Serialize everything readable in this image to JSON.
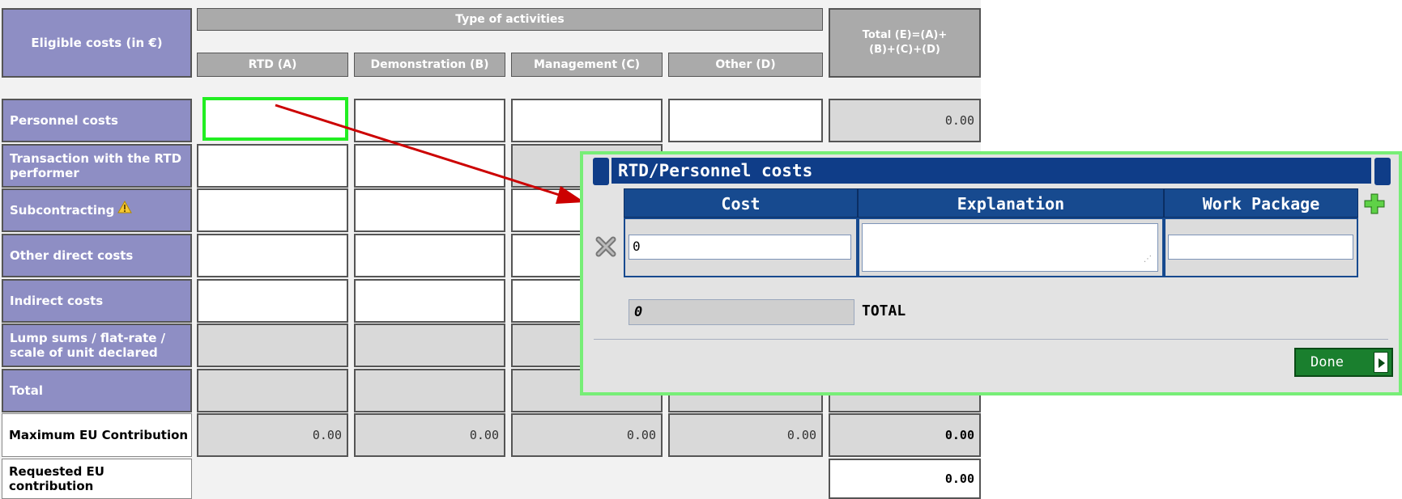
{
  "table": {
    "corner_label": "Eligible costs (in €)",
    "type_header": "Type of activities",
    "columns": [
      "RTD (A)",
      "Demonstration (B)",
      "Management (C)",
      "Other (D)"
    ],
    "total_header_line1": "Total (E)=(A)+",
    "total_header_line2": "(B)+(C)+(D)",
    "rows": [
      {
        "label": "Personnel costs",
        "total": "0.00"
      },
      {
        "label": "Transaction with the RTD performer"
      },
      {
        "label": "Subcontracting"
      },
      {
        "label": "Other direct costs"
      },
      {
        "label": "Indirect costs"
      },
      {
        "label": "Lump sums / flat-rate / scale of unit declared"
      },
      {
        "label": "Total"
      },
      {
        "label": "Maximum EU Contribution",
        "values": [
          "0.00",
          "0.00",
          "0.00",
          "0.00"
        ],
        "total": "0.00"
      },
      {
        "label": "Requested EU contribution",
        "total": "0.00"
      }
    ],
    "warning_icon": "warning-triangle-icon"
  },
  "dialog": {
    "title": "RTD/Personnel costs",
    "col_cost": "Cost",
    "col_explanation": "Explanation",
    "col_work_package": "Work Package",
    "cost_value": "0",
    "explanation_value": "",
    "work_package_value": "",
    "total_value": "0",
    "total_label": "TOTAL",
    "done_label": "Done",
    "add_icon": "plus-icon",
    "remove_icon": "x-remove-icon"
  },
  "colors": {
    "label_purple": "#8e8ec4",
    "header_grey": "#aaaaaa",
    "dialog_blue": "#0f3d88",
    "highlight_green": "#22ee22",
    "arrow_red": "#cc0000",
    "done_green": "#1a7f2e"
  }
}
